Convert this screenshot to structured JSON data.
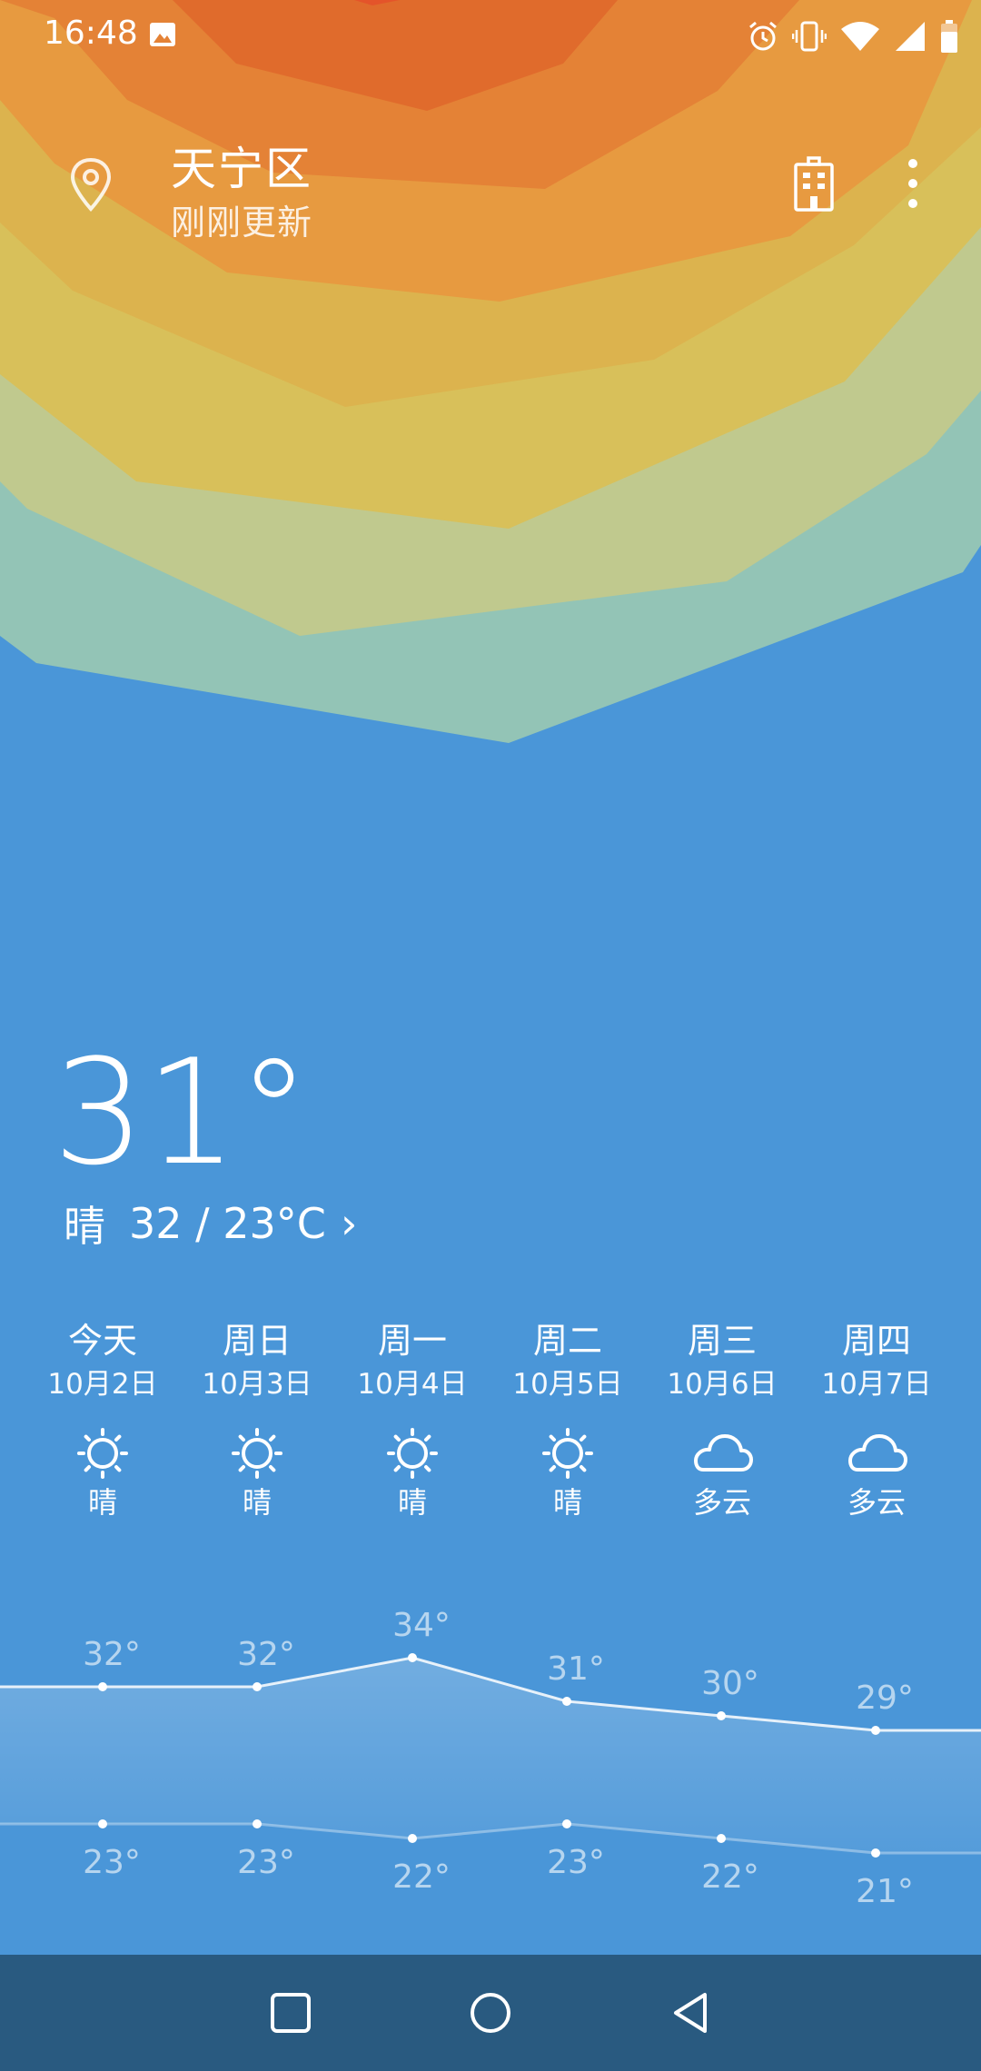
{
  "status_bar": {
    "time": "16:48",
    "icons": [
      "image-icon",
      "alarm-icon",
      "vibrate-icon",
      "wifi-icon",
      "signal-icon",
      "battery-icon"
    ]
  },
  "header": {
    "location": "天宁区",
    "update_status": "刚刚更新",
    "icons": [
      "location-pin-icon",
      "building-icon",
      "more-vertical-icon"
    ]
  },
  "current": {
    "temperature": "31°",
    "condition": "晴",
    "range": "32 / 23°C",
    "chevron": "›"
  },
  "forecast": [
    {
      "day": "今天",
      "date": "10月2日",
      "icon": "sun-icon",
      "condition": "晴"
    },
    {
      "day": "周日",
      "date": "10月3日",
      "icon": "sun-icon",
      "condition": "晴"
    },
    {
      "day": "周一",
      "date": "10月4日",
      "icon": "sun-icon",
      "condition": "晴"
    },
    {
      "day": "周二",
      "date": "10月5日",
      "icon": "sun-icon",
      "condition": "晴"
    },
    {
      "day": "周三",
      "date": "10月6日",
      "icon": "cloud-icon",
      "condition": "多云"
    },
    {
      "day": "周四",
      "date": "10月7日",
      "icon": "cloud-icon",
      "condition": "多云"
    }
  ],
  "chart_data": {
    "type": "line",
    "categories": [
      "今天",
      "周日",
      "周一",
      "周二",
      "周三",
      "周四"
    ],
    "series": [
      {
        "values": [
          32,
          32,
          34,
          31,
          30,
          29
        ],
        "labels": [
          "32°",
          "32°",
          "34°",
          "31°",
          "30°",
          "29°"
        ]
      },
      {
        "values": [
          23,
          23,
          22,
          23,
          22,
          21
        ],
        "labels": [
          "23°",
          "23°",
          "22°",
          "23°",
          "22°",
          "21°"
        ]
      }
    ]
  },
  "nav_bar": {
    "buttons": [
      "recents-square-icon",
      "home-circle-icon",
      "back-triangle-icon"
    ]
  },
  "colors": {
    "sky_blue": "#4a96d8",
    "nav_bar": "#295a80",
    "bands": [
      "#e06b2c",
      "#e48236",
      "#e79a40",
      "#dcb34e",
      "#d8c05a",
      "#c0c98e",
      "#93c4b6"
    ]
  }
}
